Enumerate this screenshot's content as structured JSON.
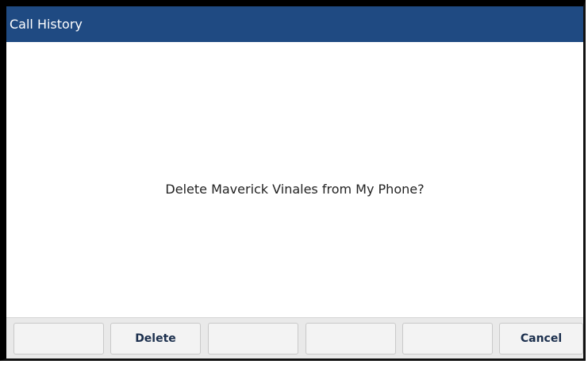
{
  "header": {
    "title": "Call History"
  },
  "dialog": {
    "message": "Delete Maverick Vinales from My Phone?"
  },
  "softkeys": [
    {
      "label": ""
    },
    {
      "label": "Delete"
    },
    {
      "label": ""
    },
    {
      "label": ""
    },
    {
      "label": ""
    },
    {
      "label": "Cancel"
    }
  ],
  "colors": {
    "header_background": "#1f4a82",
    "header_text": "#ffffff",
    "softkey_bar": "#e9e9e9",
    "softkey_text": "#1b2f4d"
  }
}
